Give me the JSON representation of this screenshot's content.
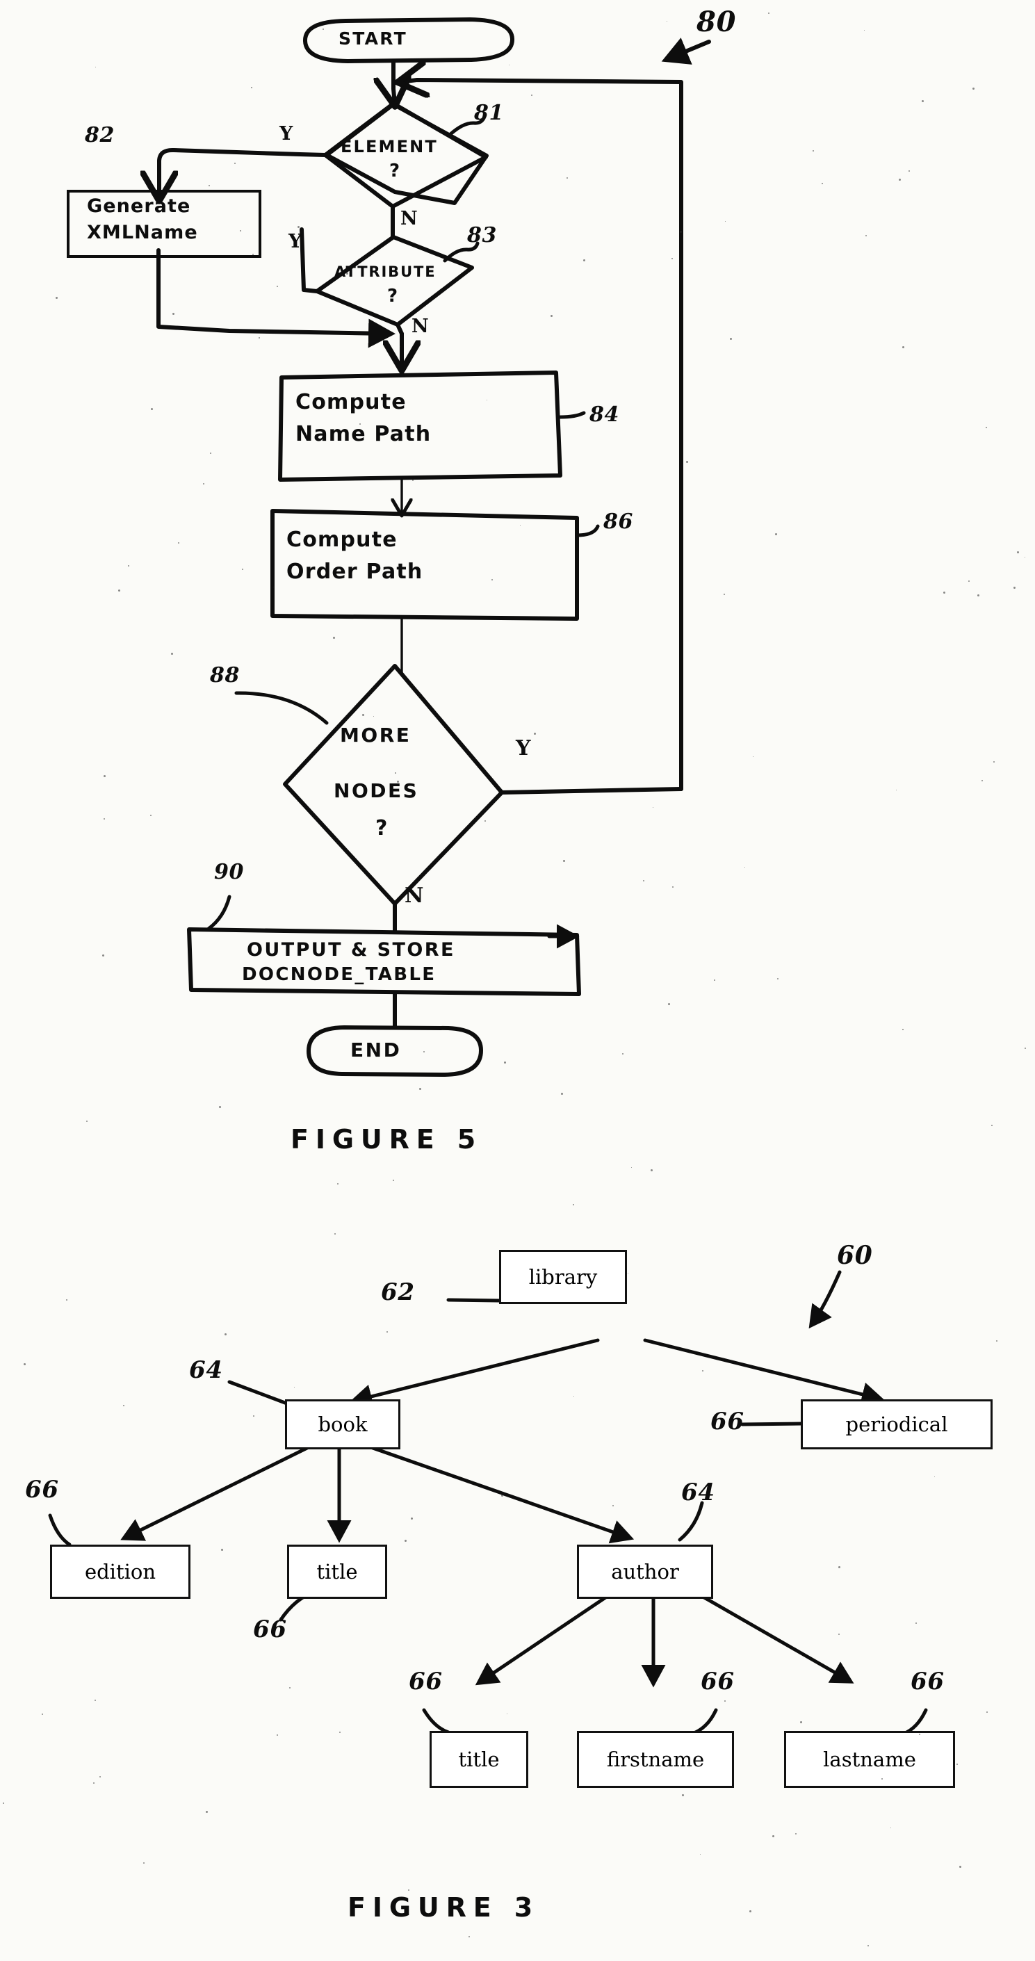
{
  "figure5": {
    "caption": "FIGURE 5",
    "overall_ref": "80",
    "nodes": {
      "start": {
        "label": "START",
        "shape": "terminator"
      },
      "element": {
        "label": "ELEMENT",
        "question": "?",
        "ref": "81",
        "shape": "decision"
      },
      "generate": {
        "line1": "Generate",
        "line2": "XMLName",
        "ref": "82",
        "shape": "process"
      },
      "attribute": {
        "label": "ATTRIBUTE",
        "question": "?",
        "ref": "83",
        "shape": "decision"
      },
      "name_path": {
        "line1": "Compute",
        "line2": "Name Path",
        "ref": "84",
        "shape": "process"
      },
      "order_path": {
        "line1": "Compute",
        "line2": "Order Path",
        "ref": "86",
        "shape": "process"
      },
      "more_nodes": {
        "line1": "MORE",
        "line2": "NODES",
        "line3": "?",
        "ref": "88",
        "shape": "decision"
      },
      "output": {
        "line1": "OUTPUT & STORE",
        "line2": "DOCNODE_TABLE",
        "ref": "90",
        "shape": "process"
      },
      "end": {
        "label": "END",
        "shape": "terminator"
      }
    },
    "branch_labels": {
      "element_yes": "Y",
      "element_no": "N",
      "attribute_yes": "Y",
      "attribute_no": "N",
      "more_nodes_yes": "Y",
      "more_nodes_no": "N"
    }
  },
  "figure3": {
    "caption": "FIGURE 3",
    "overall_ref": "60",
    "tree": {
      "root": {
        "label": "library",
        "ref": "62"
      },
      "level2": [
        {
          "label": "book",
          "ref": "64"
        },
        {
          "label": "periodical",
          "ref": "66"
        }
      ],
      "level3": [
        {
          "label": "edition",
          "ref": "66"
        },
        {
          "label": "title",
          "ref": "66"
        },
        {
          "label": "author",
          "ref": "64"
        }
      ],
      "level4": [
        {
          "label": "title",
          "ref": "66"
        },
        {
          "label": "firstname",
          "ref": "66"
        },
        {
          "label": "lastname",
          "ref": "66"
        }
      ]
    }
  }
}
